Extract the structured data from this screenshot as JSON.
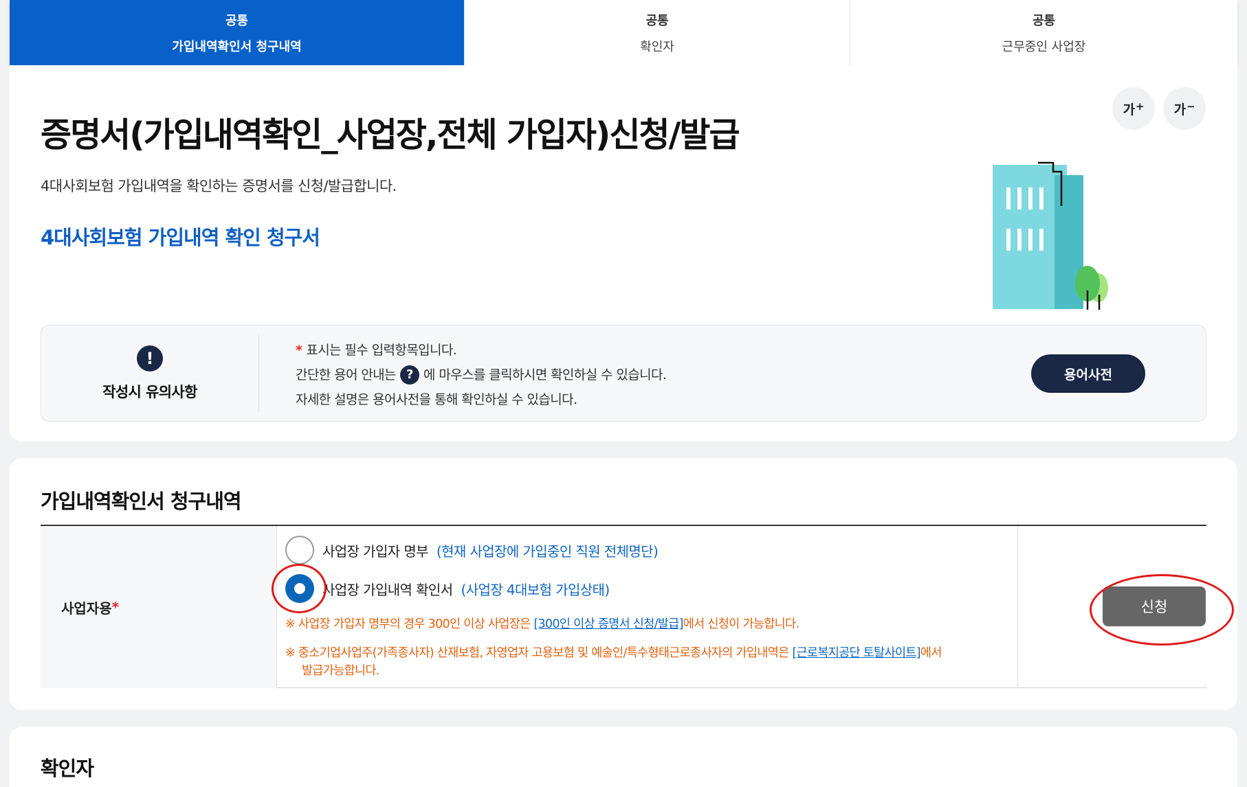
{
  "tabs": [
    {
      "category": "공통",
      "label": "가입내역확인서 청구내역",
      "active": true
    },
    {
      "category": "공통",
      "label": "확인자",
      "active": false
    },
    {
      "category": "공통",
      "label": "근무중인 사업장",
      "active": false
    }
  ],
  "font_controls": {
    "increase": "가",
    "increase_sign": "+",
    "decrease": "가",
    "decrease_sign": "−"
  },
  "header": {
    "title": "증명서(가입내역확인_사업장,전체 가입자)신청/발급",
    "description": "4대사회보험 가입내역을 확인하는 증명서를 신청/발급합니다.",
    "form_link": "4대사회보험 가입내역 확인 청구서"
  },
  "notice": {
    "title": "작성시 유의사항",
    "line1_mark": "*",
    "line1": "표시는 필수 입력항목입니다.",
    "line2_before": "간단한 용어 안내는",
    "line2_icon": "?",
    "line2_after": "에 마우스를 클릭하시면 확인하실 수 있습니다.",
    "line3": "자세한 설명은 용어사전을 통해 확인하실 수 있습니다.",
    "dict_button": "용어사전"
  },
  "claim_section": {
    "title": "가입내역확인서 청구내역",
    "row_label": "사업자용",
    "row_required": "*",
    "options": [
      {
        "label": "사업장 가입자 명부",
        "note": "(현재 사업장에 가입중인 직원 전체명단)",
        "checked": false
      },
      {
        "label": "사업장 가입내역 확인서",
        "note": "(사업장 4대보험 가입상태)",
        "checked": true
      }
    ],
    "warn1_prefix": "※  사업장 가입자 명부의 경우 300인 이상 사업장은 ",
    "warn1_link": "[300인 이상 증명서 신청/발급]",
    "warn1_suffix": "에서 신청이 가능합니다.",
    "warn2_prefix": "※  중소기업사업주(가족종사자) 산재보험, 자영업자 고용보험 및 예술인/특수형태근로종사자의 가입내역은 ",
    "warn2_link": "[근로복지공단 토탈사이트]",
    "warn2_suffix": "에서",
    "warn2_cont": "발급가능합니다.",
    "apply_button": "신청"
  },
  "confirm_section": {
    "title": "확인자"
  },
  "colors": {
    "primary": "#0861c8",
    "navy": "#1a2846",
    "warning": "#e5600d",
    "link": "#0f66c4",
    "highlight": "#e01a1a"
  }
}
